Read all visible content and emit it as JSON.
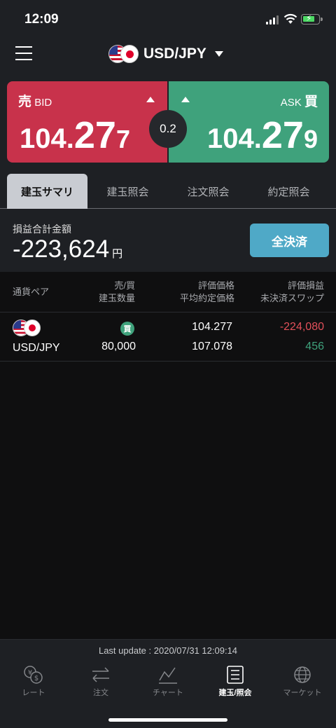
{
  "status_bar": {
    "time": "12:09"
  },
  "header": {
    "pair": "USD/JPY"
  },
  "quotes": {
    "bid": {
      "kanji": "売",
      "label": "BID",
      "price_prefix": "104.",
      "price_big": "27",
      "price_pip": "7"
    },
    "ask": {
      "kanji": "買",
      "label": "ASK",
      "price_prefix": "104.",
      "price_big": "27",
      "price_pip": "9"
    },
    "spread": "0.2"
  },
  "tabs": [
    {
      "label": "建玉サマリ",
      "active": true
    },
    {
      "label": "建玉照会",
      "active": false
    },
    {
      "label": "注文照会",
      "active": false
    },
    {
      "label": "約定照会",
      "active": false
    }
  ],
  "summary": {
    "label": "損益合計金額",
    "value": "-223,624",
    "unit": "円",
    "close_all_label": "全決済"
  },
  "table": {
    "headers": {
      "pair": "通貨ペア",
      "side_line1": "売/買",
      "side_line2": "建玉数量",
      "price_line1": "評価価格",
      "price_line2": "平均約定価格",
      "pl_line1": "評価損益",
      "pl_line2": "未決済スワップ"
    },
    "rows": [
      {
        "pair": "USD/JPY",
        "side_badge": "買",
        "quantity": "80,000",
        "eval_price": "104.277",
        "avg_price": "107.078",
        "eval_pl": "-224,080",
        "swap": "456"
      }
    ]
  },
  "footer": {
    "last_update": "Last update : 2020/07/31 12:09:14",
    "nav": [
      {
        "label": "レート",
        "icon": "currency-exchange-icon"
      },
      {
        "label": "注文",
        "icon": "order-arrows-icon"
      },
      {
        "label": "チャート",
        "icon": "chart-line-icon"
      },
      {
        "label": "建玉/照会",
        "icon": "list-icon",
        "active": true
      },
      {
        "label": "マーケット",
        "icon": "globe-icon"
      }
    ]
  },
  "colors": {
    "bid": "#c8324b",
    "ask": "#3fa27c",
    "close_all": "#4fa9c7",
    "negative": "#e2505a",
    "positive": "#3fa27c"
  }
}
